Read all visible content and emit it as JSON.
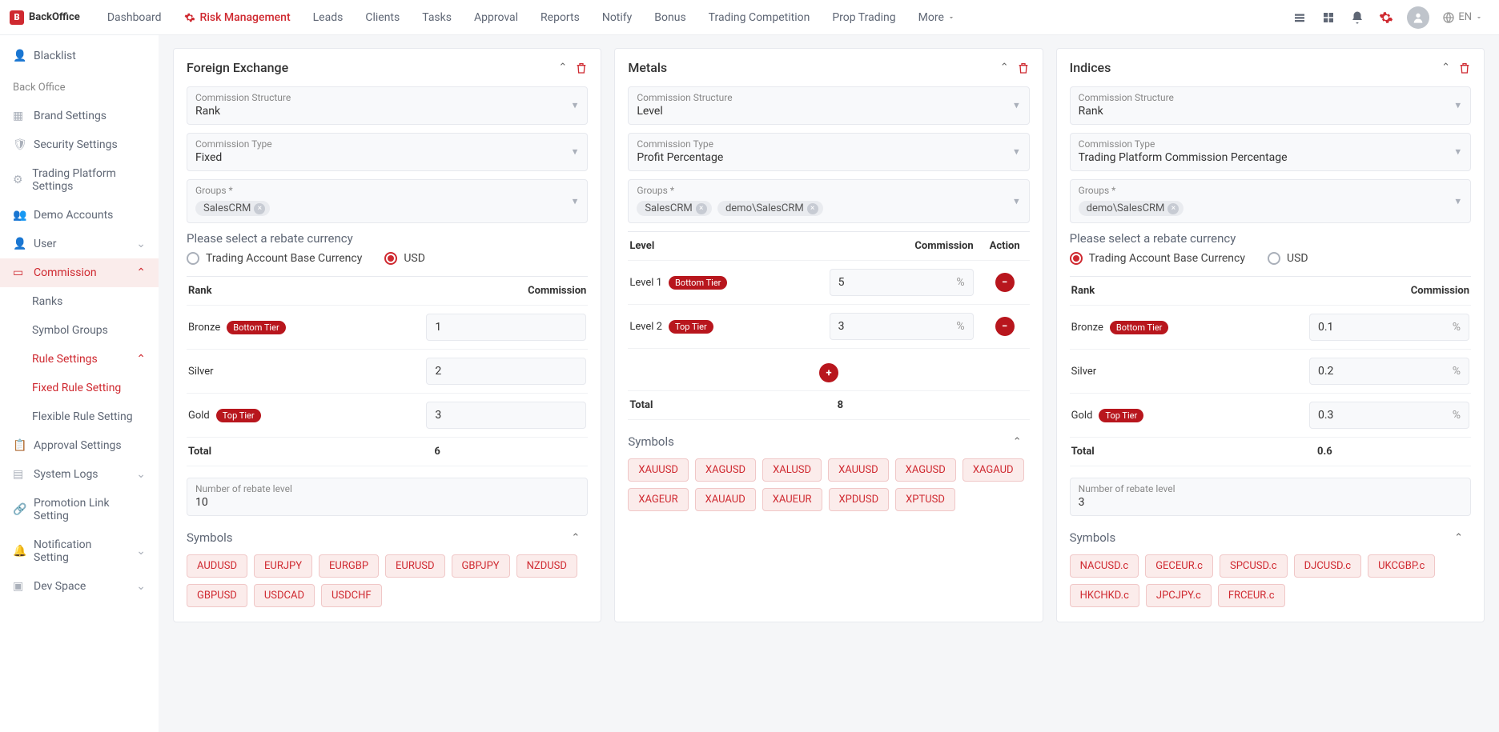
{
  "brand": "BackOffice",
  "nav": {
    "items": [
      "Dashboard",
      "Risk Management",
      "Leads",
      "Clients",
      "Tasks",
      "Approval",
      "Reports",
      "Notify",
      "Bonus",
      "Trading Competition",
      "Prop Trading"
    ],
    "more": "More",
    "lang": "EN"
  },
  "sidebar": {
    "blacklist": "Blacklist",
    "section": "Back Office",
    "brand_settings": "Brand Settings",
    "security_settings": "Security Settings",
    "trading_platform_settings": "Trading Platform Settings",
    "demo_accounts": "Demo Accounts",
    "user": "User",
    "commission": "Commission",
    "ranks": "Ranks",
    "symbol_groups": "Symbol Groups",
    "rule_settings": "Rule Settings",
    "fixed_rule_setting": "Fixed Rule Setting",
    "flexible_rule_setting": "Flexible Rule Setting",
    "approval_settings": "Approval Settings",
    "system_logs": "System Logs",
    "promotion_link_setting": "Promotion Link Setting",
    "notification_setting": "Notification Setting",
    "dev_space": "Dev Space"
  },
  "labels": {
    "commission_structure": "Commission Structure",
    "commission_type": "Commission Type",
    "groups": "Groups *",
    "select_currency": "Please select a rebate currency",
    "radio_base": "Trading Account Base Currency",
    "radio_usd": "USD",
    "rank": "Rank",
    "commission": "Commission",
    "total": "Total",
    "number_rebate": "Number of rebate level",
    "symbols": "Symbols",
    "level": "Level",
    "action": "Action",
    "bottom_tier": "Bottom Tier",
    "top_tier": "Top Tier",
    "level1": "Level 1",
    "level2": "Level 2"
  },
  "cards": {
    "fx": {
      "title": "Foreign Exchange",
      "structure": "Rank",
      "type": "Fixed",
      "groups": [
        "SalesCRM"
      ],
      "currency_selected": "usd",
      "ranks": [
        {
          "name": "Bronze",
          "badge": "Bottom Tier",
          "value": "1"
        },
        {
          "name": "Silver",
          "badge": "",
          "value": "2"
        },
        {
          "name": "Gold",
          "badge": "Top Tier",
          "value": "3"
        }
      ],
      "total": "6",
      "rebate_levels": "10",
      "symbols": [
        "AUDUSD",
        "EURJPY",
        "EURGBP",
        "EURUSD",
        "GBPJPY",
        "NZDUSD",
        "GBPUSD",
        "USDCAD",
        "USDCHF"
      ]
    },
    "metals": {
      "title": "Metals",
      "structure": "Level",
      "type": "Profit Percentage",
      "groups": [
        "SalesCRM",
        "demo\\SalesCRM"
      ],
      "levels": [
        {
          "name": "Level 1",
          "badge": "Bottom Tier",
          "value": "5"
        },
        {
          "name": "Level 2",
          "badge": "Top Tier",
          "value": "3"
        }
      ],
      "total": "8",
      "symbols": [
        "XAUUSD",
        "XAGUSD",
        "XALUSD",
        "XAUUSD",
        "XAGUSD",
        "XAGAUD",
        "XAGEUR",
        "XAUAUD",
        "XAUEUR",
        "XPDUSD",
        "XPTUSD"
      ]
    },
    "indices": {
      "title": "Indices",
      "structure": "Rank",
      "type": "Trading Platform Commission Percentage",
      "groups": [
        "demo\\SalesCRM"
      ],
      "currency_selected": "base",
      "ranks": [
        {
          "name": "Bronze",
          "badge": "Bottom Tier",
          "value": "0.1"
        },
        {
          "name": "Silver",
          "badge": "",
          "value": "0.2"
        },
        {
          "name": "Gold",
          "badge": "Top Tier",
          "value": "0.3"
        }
      ],
      "total": "0.6",
      "rebate_levels": "3",
      "symbols": [
        "NACUSD.c",
        "GECEUR.c",
        "SPCUSD.c",
        "DJCUSD.c",
        "UKCGBP.c",
        "HKCHKD.c",
        "JPCJPY.c",
        "FRCEUR.c"
      ]
    }
  }
}
